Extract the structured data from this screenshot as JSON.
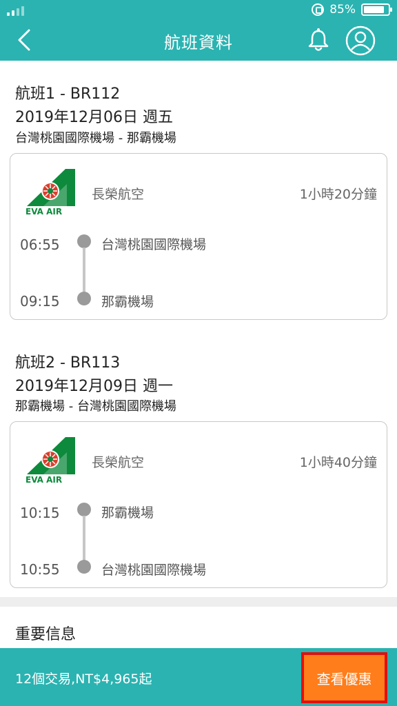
{
  "status_bar": {
    "battery": "85%",
    "battery_level": 0.85
  },
  "header": {
    "title": "航班資料"
  },
  "icons": {
    "back": "chevron-left-icon",
    "bell": "bell-icon",
    "avatar": "user-avatar-icon",
    "status_lock": "rotation-lock-icon",
    "battery": "battery-icon",
    "signal": "signal-icon"
  },
  "flights": [
    {
      "number": "航班1 - BR112",
      "date": "2019年12月06日 週五",
      "route": "台灣桃園國際機場 - 那霸機場",
      "airline": "長榮航空",
      "duration": "1小時20分鐘",
      "depart_time": "06:55",
      "depart_airport": "台灣桃園國際機場",
      "arrive_time": "09:15",
      "arrive_airport": "那霸機場"
    },
    {
      "number": "航班2 - BR113",
      "date": "2019年12月09日 週一",
      "route": "那霸機場 - 台灣桃園國際機場",
      "airline": "長榮航空",
      "duration": "1小時40分鐘",
      "depart_time": "10:15",
      "depart_airport": "那霸機場",
      "arrive_time": "10:55",
      "arrive_airport": "台灣桃園國際機場"
    }
  ],
  "logo": {
    "text": "EVA AIR"
  },
  "info": {
    "title": "重要信息"
  },
  "bottom_bar": {
    "deal_text": "12個交易,NT$4,965起",
    "button_label": "查看優惠"
  },
  "colors": {
    "teal": "#2ab3b1",
    "orange": "#ff7d1a",
    "highlight_red": "#e01010",
    "eva_green": "#0d8a3c"
  }
}
